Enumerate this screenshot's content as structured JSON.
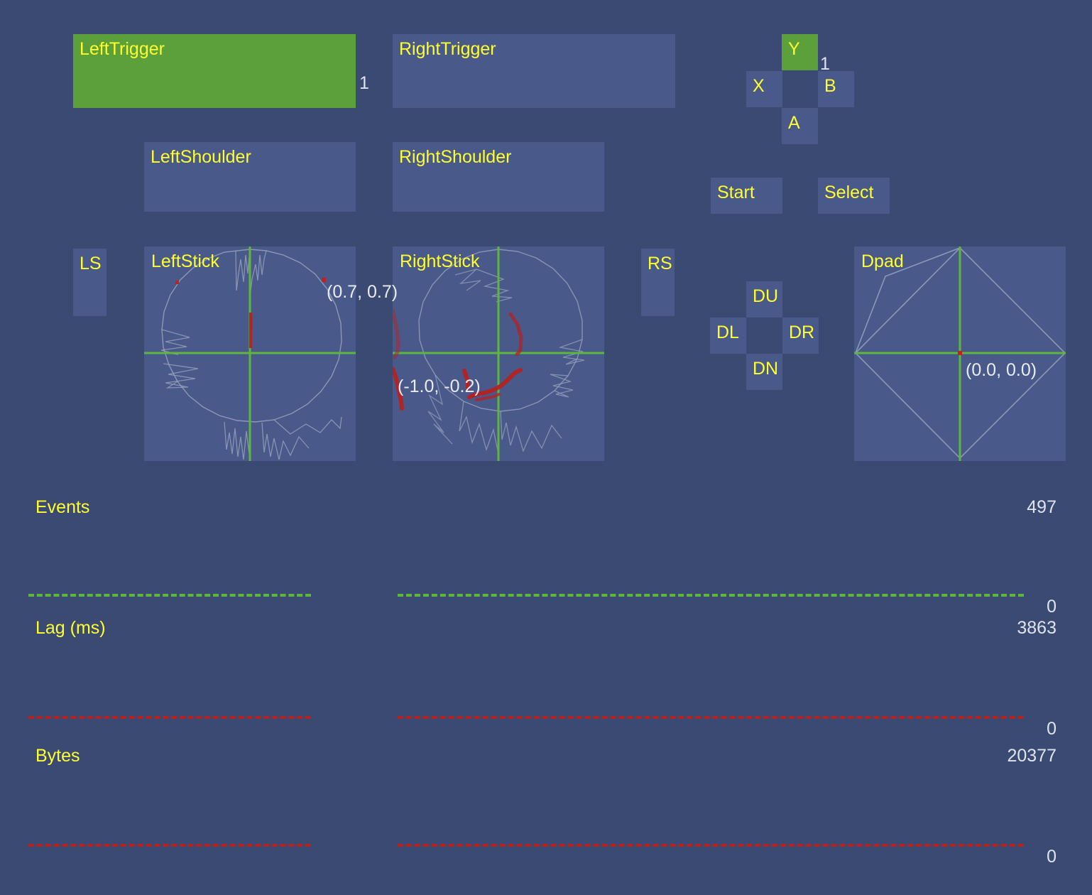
{
  "theme": {
    "background": "#3a4a72",
    "panel": "#48598a",
    "panel_active": "#5ba03a",
    "label_color": "#ffff2e",
    "value_color": "#dfe3ee",
    "axis_green": "#5db73c",
    "marker_red": "#b52222",
    "trace_grey": "#9aa3bd"
  },
  "triggers": [
    {
      "name": "left-trigger",
      "label": "LeftTrigger",
      "value": "1",
      "fill": 1.0,
      "active": true
    },
    {
      "name": "right-trigger",
      "label": "RightTrigger",
      "value": "",
      "fill": 0.0,
      "active": false
    }
  ],
  "shoulders": [
    {
      "name": "left-shoulder",
      "label": "LeftShoulder",
      "active": false
    },
    {
      "name": "right-shoulder",
      "label": "RightShoulder",
      "active": false
    }
  ],
  "face_buttons": [
    {
      "name": "button-y",
      "label": "Y",
      "active": true,
      "value": "1"
    },
    {
      "name": "button-x",
      "label": "X",
      "active": false,
      "value": ""
    },
    {
      "name": "button-b",
      "label": "B",
      "active": false,
      "value": ""
    },
    {
      "name": "button-a",
      "label": "A",
      "active": false,
      "value": ""
    }
  ],
  "system_buttons": [
    {
      "name": "button-start",
      "label": "Start",
      "active": false
    },
    {
      "name": "button-select",
      "label": "Select",
      "active": false
    }
  ],
  "stick_buttons": [
    {
      "name": "button-ls",
      "label": "LS",
      "active": false
    },
    {
      "name": "button-rs",
      "label": "RS",
      "active": false
    }
  ],
  "dpad_buttons": [
    {
      "name": "dpad-up",
      "label": "DU",
      "active": false
    },
    {
      "name": "dpad-left",
      "label": "DL",
      "active": false
    },
    {
      "name": "dpad-right",
      "label": "DR",
      "active": false
    },
    {
      "name": "dpad-down",
      "label": "DN",
      "active": false
    }
  ],
  "sticks": [
    {
      "name": "left-stick",
      "label": "LeftStick",
      "coord": "(0.7, 0.7)"
    },
    {
      "name": "right-stick",
      "label": "RightStick",
      "coord": "(-1.0, -0.2)"
    }
  ],
  "dpad_plot": {
    "name": "dpad-plot",
    "label": "Dpad",
    "coord": "(0.0, 0.0)"
  },
  "graphs": [
    {
      "name": "events-graph",
      "label": "Events",
      "values": [
        "497"
      ]
    },
    {
      "name": "lag-graph",
      "label": "Lag (ms)",
      "values": [
        "0",
        "3863"
      ]
    },
    {
      "name": "bytes-graph",
      "label": "Bytes",
      "values": [
        "0",
        "20377"
      ]
    },
    {
      "name": "extra-graph",
      "label": "",
      "values": [
        "0"
      ]
    }
  ]
}
